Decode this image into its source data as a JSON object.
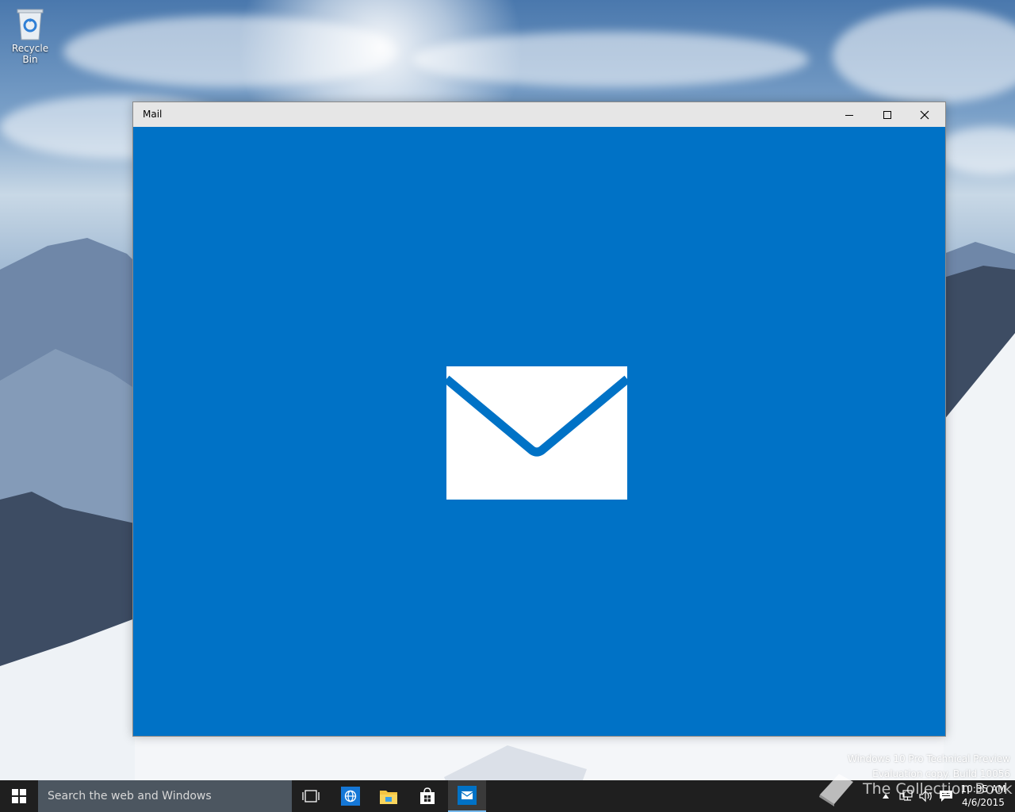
{
  "desktop": {
    "recycle_bin_label": "Recycle Bin",
    "watermark_line1": "Windows 10 Pro Technical Preview",
    "watermark_line2": "Evaluation copy. Build 10056",
    "brand_mark": "The Collection Book"
  },
  "window": {
    "title": "Mail",
    "accent_color": "#0072c6",
    "splash_icon": "mail-envelope-icon"
  },
  "taskbar": {
    "search_placeholder": "Search the web and Windows",
    "pinned": [
      "task-view-icon",
      "internet-explorer-icon",
      "file-explorer-icon",
      "store-icon",
      "mail-icon"
    ],
    "active_app": "mail-icon",
    "clock_time": "10:35 AM",
    "clock_date": "4/6/2015"
  }
}
